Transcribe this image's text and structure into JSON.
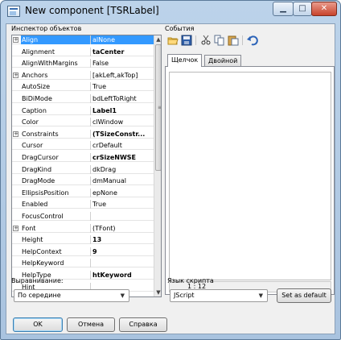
{
  "window": {
    "title": "New component [TSRLabel]"
  },
  "inspector": {
    "title": "Инспектор объектов",
    "properties": [
      {
        "name": "Align",
        "value": "alNone",
        "bold": false,
        "expandable": true,
        "selected": true
      },
      {
        "name": "Alignment",
        "value": "taCenter",
        "bold": true,
        "expandable": false
      },
      {
        "name": "AlignWithMargins",
        "value": "False",
        "bold": false,
        "expandable": false
      },
      {
        "name": "Anchors",
        "value": "[akLeft,akTop]",
        "bold": false,
        "expandable": true
      },
      {
        "name": "AutoSize",
        "value": "True",
        "bold": false,
        "expandable": false
      },
      {
        "name": "BiDiMode",
        "value": "bdLeftToRight",
        "bold": false,
        "expandable": false
      },
      {
        "name": "Caption",
        "value": "Label1",
        "bold": true,
        "expandable": false
      },
      {
        "name": "Color",
        "value": "clWindow",
        "bold": false,
        "expandable": false
      },
      {
        "name": "Constraints",
        "value": "(TSizeConstr...",
        "bold": true,
        "expandable": true
      },
      {
        "name": "Cursor",
        "value": "crDefault",
        "bold": false,
        "expandable": false
      },
      {
        "name": "DragCursor",
        "value": "crSizeNWSE",
        "bold": true,
        "expandable": false
      },
      {
        "name": "DragKind",
        "value": "dkDrag",
        "bold": false,
        "expandable": false
      },
      {
        "name": "DragMode",
        "value": "dmManual",
        "bold": false,
        "expandable": false
      },
      {
        "name": "EllipsisPosition",
        "value": "epNone",
        "bold": false,
        "expandable": false
      },
      {
        "name": "Enabled",
        "value": "True",
        "bold": false,
        "expandable": false
      },
      {
        "name": "FocusControl",
        "value": "",
        "bold": false,
        "expandable": false
      },
      {
        "name": "Font",
        "value": "(TFont)",
        "bold": false,
        "expandable": true
      },
      {
        "name": "Height",
        "value": "13",
        "bold": true,
        "expandable": false
      },
      {
        "name": "HelpContext",
        "value": "9",
        "bold": true,
        "expandable": false
      },
      {
        "name": "HelpKeyword",
        "value": "",
        "bold": false,
        "expandable": false
      },
      {
        "name": "HelpType",
        "value": "htKeyword",
        "bold": true,
        "expandable": false
      },
      {
        "name": "Hint",
        "value": "",
        "bold": false,
        "expandable": false
      }
    ]
  },
  "alignment": {
    "label": "Выравнивание:",
    "value": "По середине"
  },
  "events": {
    "title": "События",
    "tabs": [
      {
        "label": "Щелчок",
        "active": true
      },
      {
        "label": "Двойной щелчок",
        "active": false
      }
    ],
    "cursor_position": "1 : 12"
  },
  "script": {
    "label": "Язык скрипта",
    "value": "JScript",
    "default_button": "Set as default"
  },
  "footer": {
    "ok": "OK",
    "cancel": "Отмена",
    "help": "Справка"
  },
  "colors": {
    "selection": "#3399ff",
    "window_frame": "#a9c3df",
    "close_button": "#c8432c"
  },
  "toolbar_icons": [
    "open-folder-icon",
    "save-icon",
    "cut-icon",
    "copy-icon",
    "paste-icon",
    "undo-icon"
  ]
}
